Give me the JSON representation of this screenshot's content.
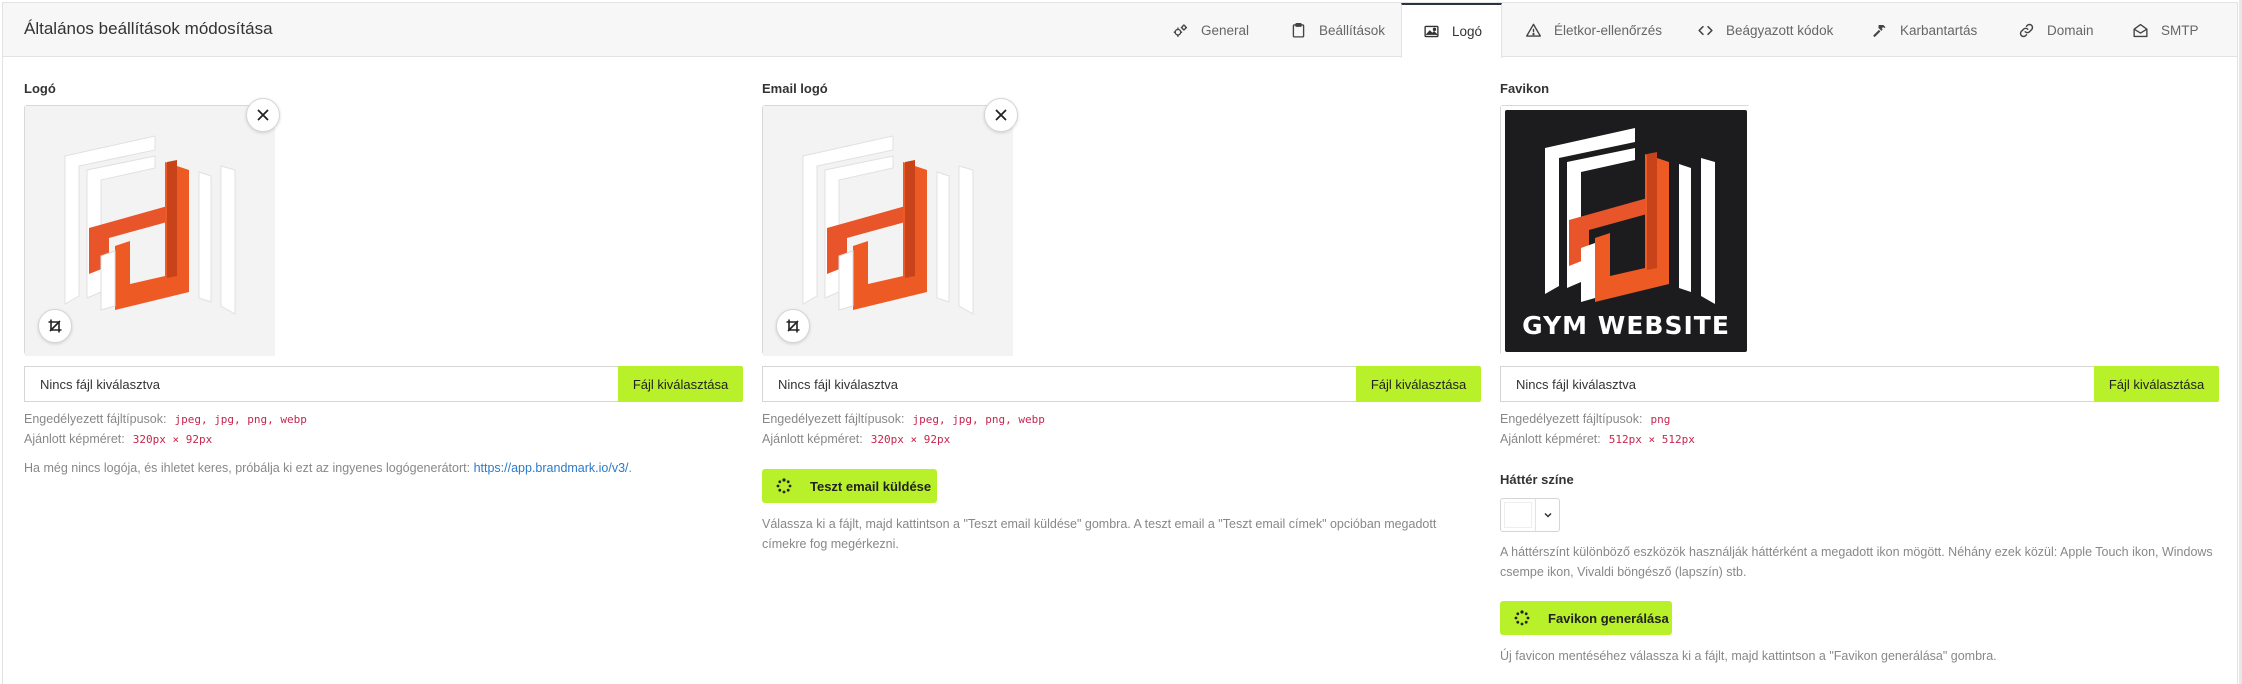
{
  "header": {
    "title": "Általános beállítások módosítása",
    "tabs": [
      {
        "label": "General",
        "icon": "gears-icon",
        "active": false
      },
      {
        "label": "Beállítások",
        "icon": "clipboard-icon",
        "active": false
      },
      {
        "label": "Logó",
        "icon": "image-icon",
        "active": true
      },
      {
        "label": "Életkor-ellenőrzés",
        "icon": "warning-icon",
        "active": false
      },
      {
        "label": "Beágyazott kódok",
        "icon": "code-icon",
        "active": false
      },
      {
        "label": "Karbantartás",
        "icon": "hammer-icon",
        "active": false
      },
      {
        "label": "Domain",
        "icon": "link-icon",
        "active": false
      },
      {
        "label": "SMTP",
        "icon": "envelope-open-icon",
        "active": false
      }
    ]
  },
  "logo": {
    "label": "Logó",
    "file_placeholder": "Nincs fájl kiválasztva",
    "file_button": "Fájl kiválasztása",
    "allowed_label": "Engedélyezett fájltípusok:",
    "allowed_types": "jpeg, jpg, png, webp",
    "size_label": "Ajánlott képméret:",
    "size_value": "320px × 92px",
    "help_text": "Ha még nincs logója, és ihletet keres, próbálja ki ezt az ingyenes logógenerátort:",
    "help_link": "https://app.brandmark.io/v3/",
    "help_suffix": "."
  },
  "email_logo": {
    "label": "Email logó",
    "file_placeholder": "Nincs fájl kiválasztva",
    "file_button": "Fájl kiválasztása",
    "allowed_label": "Engedélyezett fájltípusok:",
    "allowed_types": "jpeg, jpg, png, webp",
    "size_label": "Ajánlott képméret:",
    "size_value": "320px × 92px",
    "test_button": "Teszt email küldése",
    "description": "Válassza ki a fájlt, majd kattintson a \"Teszt email küldése\" gombra. A teszt email a \"Teszt email címek\" opcióban megadott címekre fog megérkezni."
  },
  "favicon": {
    "label": "Favikon",
    "image_text": "GYM WEBSITE",
    "file_placeholder": "Nincs fájl kiválasztva",
    "file_button": "Fájl kiválasztása",
    "allowed_label": "Engedélyezett fájltípusok:",
    "allowed_types": "png",
    "size_label": "Ajánlott képméret:",
    "size_value": "512px × 512px",
    "bg_label": "Háttér színe",
    "bg_color": "#ffffff",
    "bg_description": "A háttérszínt különböző eszközök használják háttérként a megadott ikon mögött. Néhány ezek közül: Apple Touch ikon, Windows csempe ikon, Vivaldi böngésző (lapszín) stb.",
    "generate_button": "Favikon generálása",
    "generate_description": "Új favicon mentéséhez válassza ki a fájlt, majd kattintson a \"Favikon generálása\" gombra."
  },
  "colors": {
    "accent": "#b8f02a",
    "brand_orange": "#ee5a24",
    "link": "#2a7ac9",
    "code": "#c7254e"
  }
}
